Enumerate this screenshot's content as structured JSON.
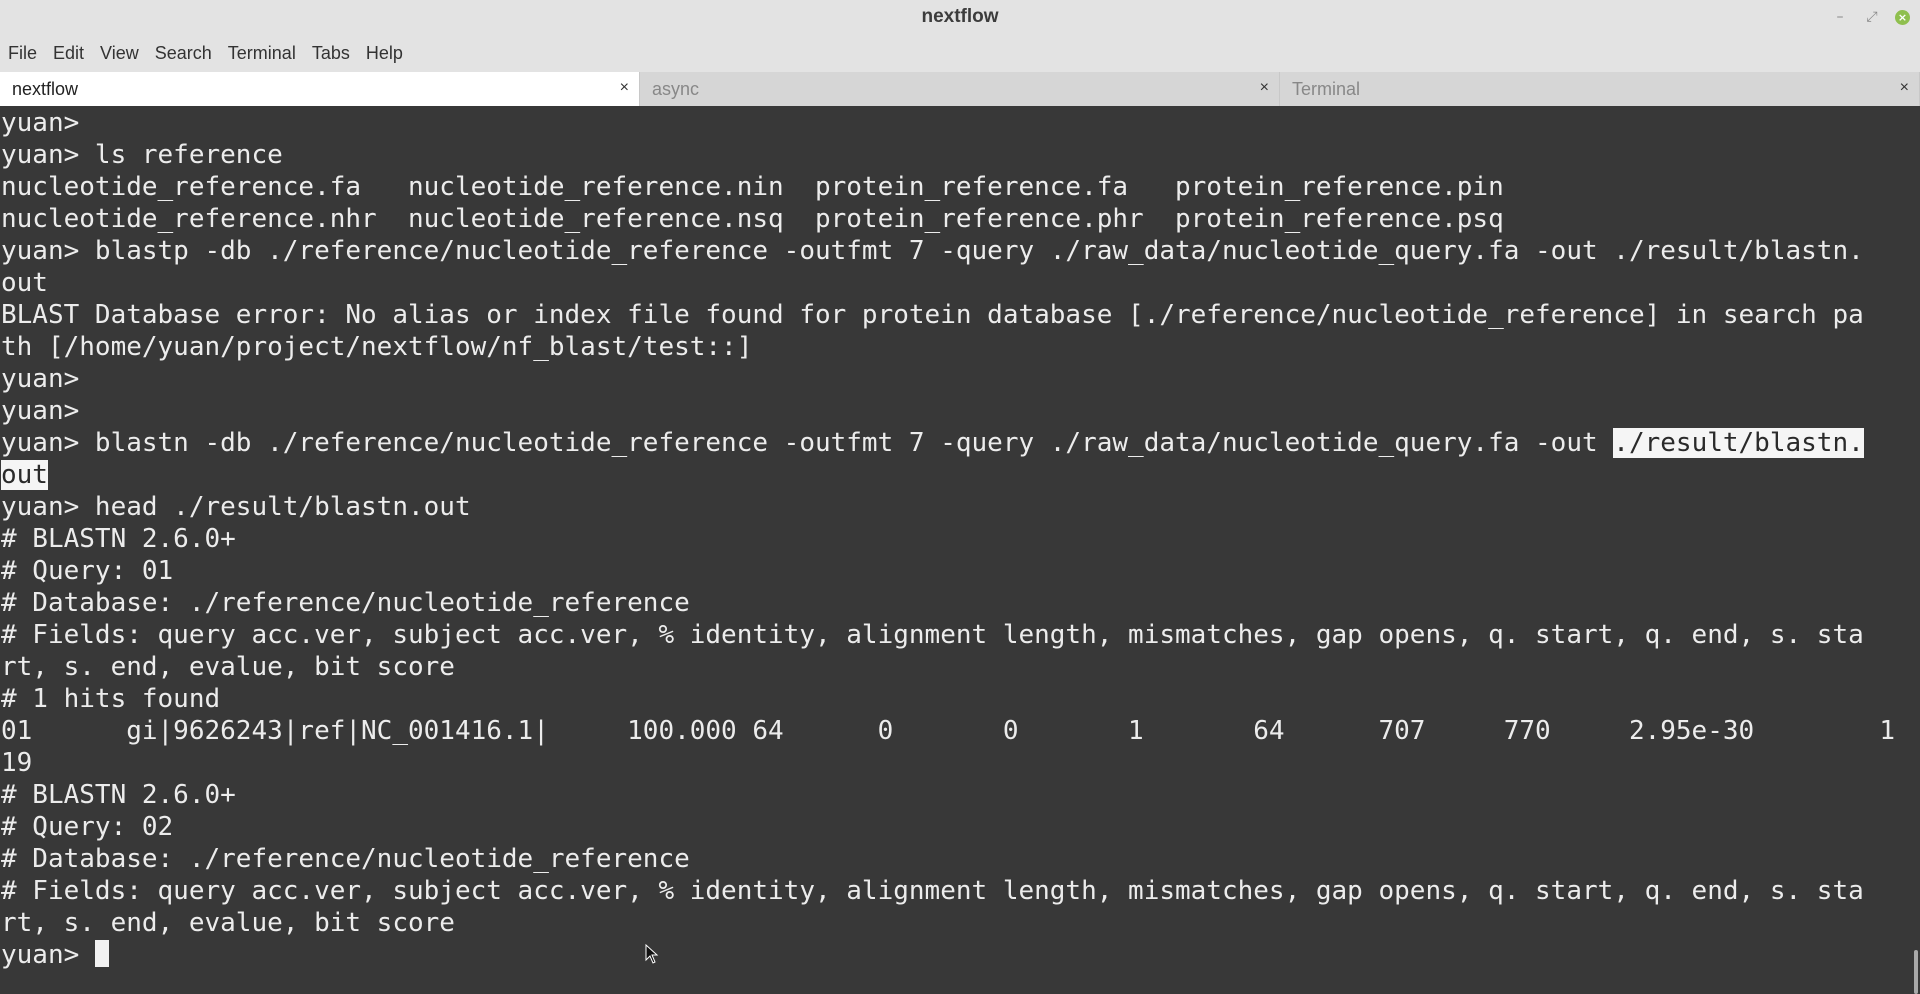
{
  "window": {
    "title": "nextflow"
  },
  "menu": [
    "File",
    "Edit",
    "View",
    "Search",
    "Terminal",
    "Tabs",
    "Help"
  ],
  "tabs": [
    {
      "label": "nextflow",
      "active": true
    },
    {
      "label": "async",
      "active": false
    },
    {
      "label": "Terminal",
      "active": false
    }
  ],
  "terminal": {
    "lines": [
      "yuan>",
      "yuan> ls reference",
      "nucleotide_reference.fa   nucleotide_reference.nin  protein_reference.fa   protein_reference.pin",
      "nucleotide_reference.nhr  nucleotide_reference.nsq  protein_reference.phr  protein_reference.psq",
      "yuan> blastp -db ./reference/nucleotide_reference -outfmt 7 -query ./raw_data/nucleotide_query.fa -out ./result/blastn.",
      "out",
      "BLAST Database error: No alias or index file found for protein database [./reference/nucleotide_reference] in search pa",
      "th [/home/yuan/project/nextflow/nf_blast/test::]",
      "yuan>",
      "yuan>",
      {
        "pre": "yuan> blastn -db ./reference/nucleotide_reference -outfmt 7 -query ./raw_data/nucleotide_query.fa -out ",
        "sel": "./result/blastn."
      },
      {
        "pre": "",
        "sel": "out"
      },
      "yuan> head ./result/blastn.out",
      "# BLASTN 2.6.0+",
      "# Query: 01",
      "# Database: ./reference/nucleotide_reference",
      "# Fields: query acc.ver, subject acc.ver, % identity, alignment length, mismatches, gap opens, q. start, q. end, s. sta",
      "rt, s. end, evalue, bit score",
      "# 1 hits found",
      "01      gi|9626243|ref|NC_001416.1|     100.000 64      0       0       1       64      707     770     2.95e-30        1",
      "19",
      "# BLASTN 2.6.0+",
      "# Query: 02",
      "# Database: ./reference/nucleotide_reference",
      "# Fields: query acc.ver, subject acc.ver, % identity, alignment length, mismatches, gap opens, q. start, q. end, s. sta",
      "rt, s. end, evalue, bit score"
    ],
    "prompt": "yuan> "
  }
}
